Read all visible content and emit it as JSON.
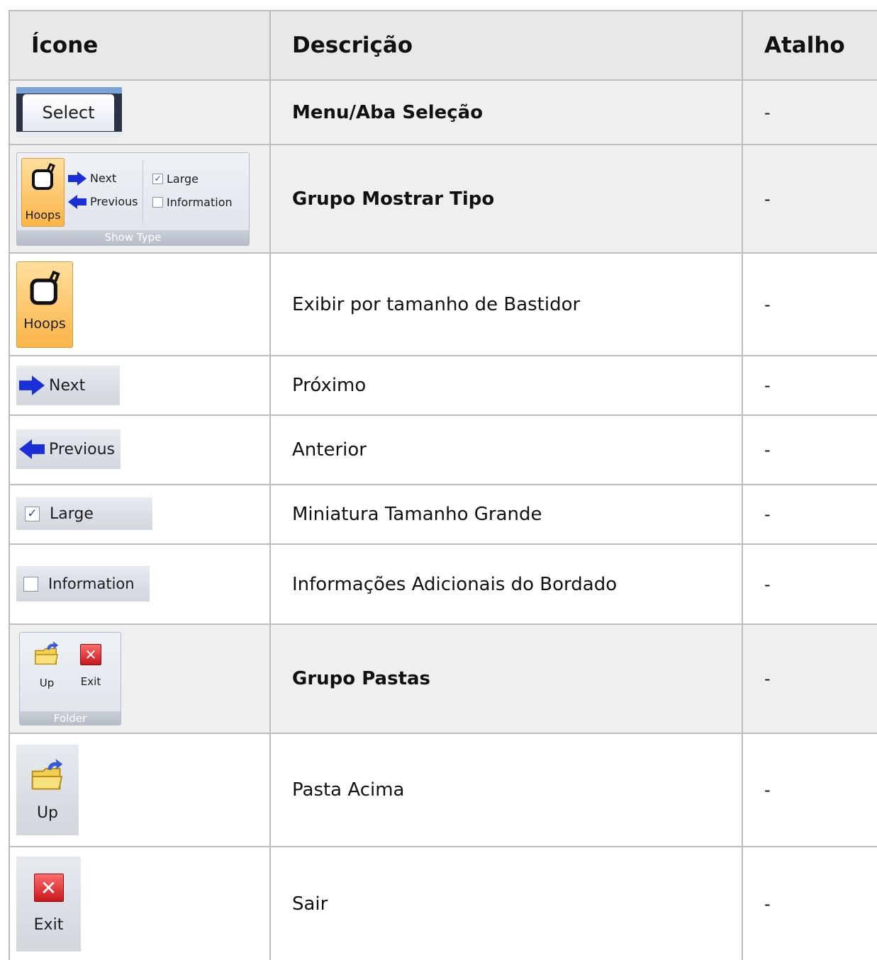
{
  "table": {
    "headers": {
      "icon": "Ícone",
      "description": "Descrição",
      "shortcut": "Atalho"
    },
    "rows": [
      {
        "description": "Menu/Aba Seleção",
        "shortcut": "-"
      },
      {
        "description": "Grupo Mostrar Tipo",
        "shortcut": "-"
      },
      {
        "description": "Exibir por tamanho de Bastidor",
        "shortcut": "-"
      },
      {
        "description": "Próximo",
        "shortcut": "-"
      },
      {
        "description": "Anterior",
        "shortcut": "-"
      },
      {
        "description": "Miniatura Tamanho Grande",
        "shortcut": "-"
      },
      {
        "description": "Informações Adicionais do Bordado",
        "shortcut": "-"
      },
      {
        "description": "Grupo Pastas",
        "shortcut": "-"
      },
      {
        "description": "Pasta Acima",
        "shortcut": "-"
      },
      {
        "description": "Sair",
        "shortcut": "-"
      }
    ]
  },
  "ribbon": {
    "select_tab": "Select",
    "hoops": "Hoops",
    "next": "Next",
    "previous": "Previous",
    "large": "Large",
    "large_checked": true,
    "information": "Information",
    "information_checked": false,
    "show_type_group": "Show Type",
    "up": "Up",
    "exit": "Exit",
    "folder_group": "Folder"
  },
  "icons": {
    "hoop": "hoop-frame-icon",
    "next": "arrow-right-icon",
    "previous": "arrow-left-icon",
    "check": "checkbox-checked-icon",
    "uncheck": "checkbox-empty-icon",
    "folder_up": "folder-up-icon",
    "exit": "close-x-icon"
  },
  "colors": {
    "header_bg": "#e8e8e8",
    "group_row_bg": "#efefef",
    "border": "#bdbdbd",
    "arrow_blue": "#1a2fd8",
    "hoops_orange": "#fbb447",
    "exit_red": "#c9171b"
  }
}
